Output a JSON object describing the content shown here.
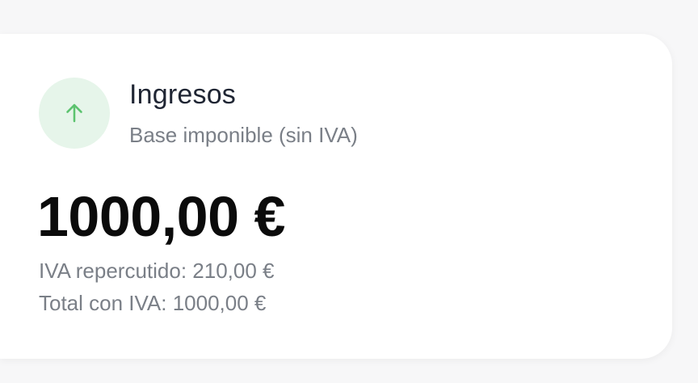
{
  "card": {
    "icon": "arrow-up-icon",
    "accent_color": "#5cc36f",
    "icon_bg_color": "#e6f5ea",
    "title": "Ingresos",
    "subtitle": "Base imponible (sin IVA)",
    "amount": "1000,00 €",
    "iva_line": "IVA repercutido: 210,00 €",
    "total_line": "Total con IVA: 1000,00 €"
  }
}
